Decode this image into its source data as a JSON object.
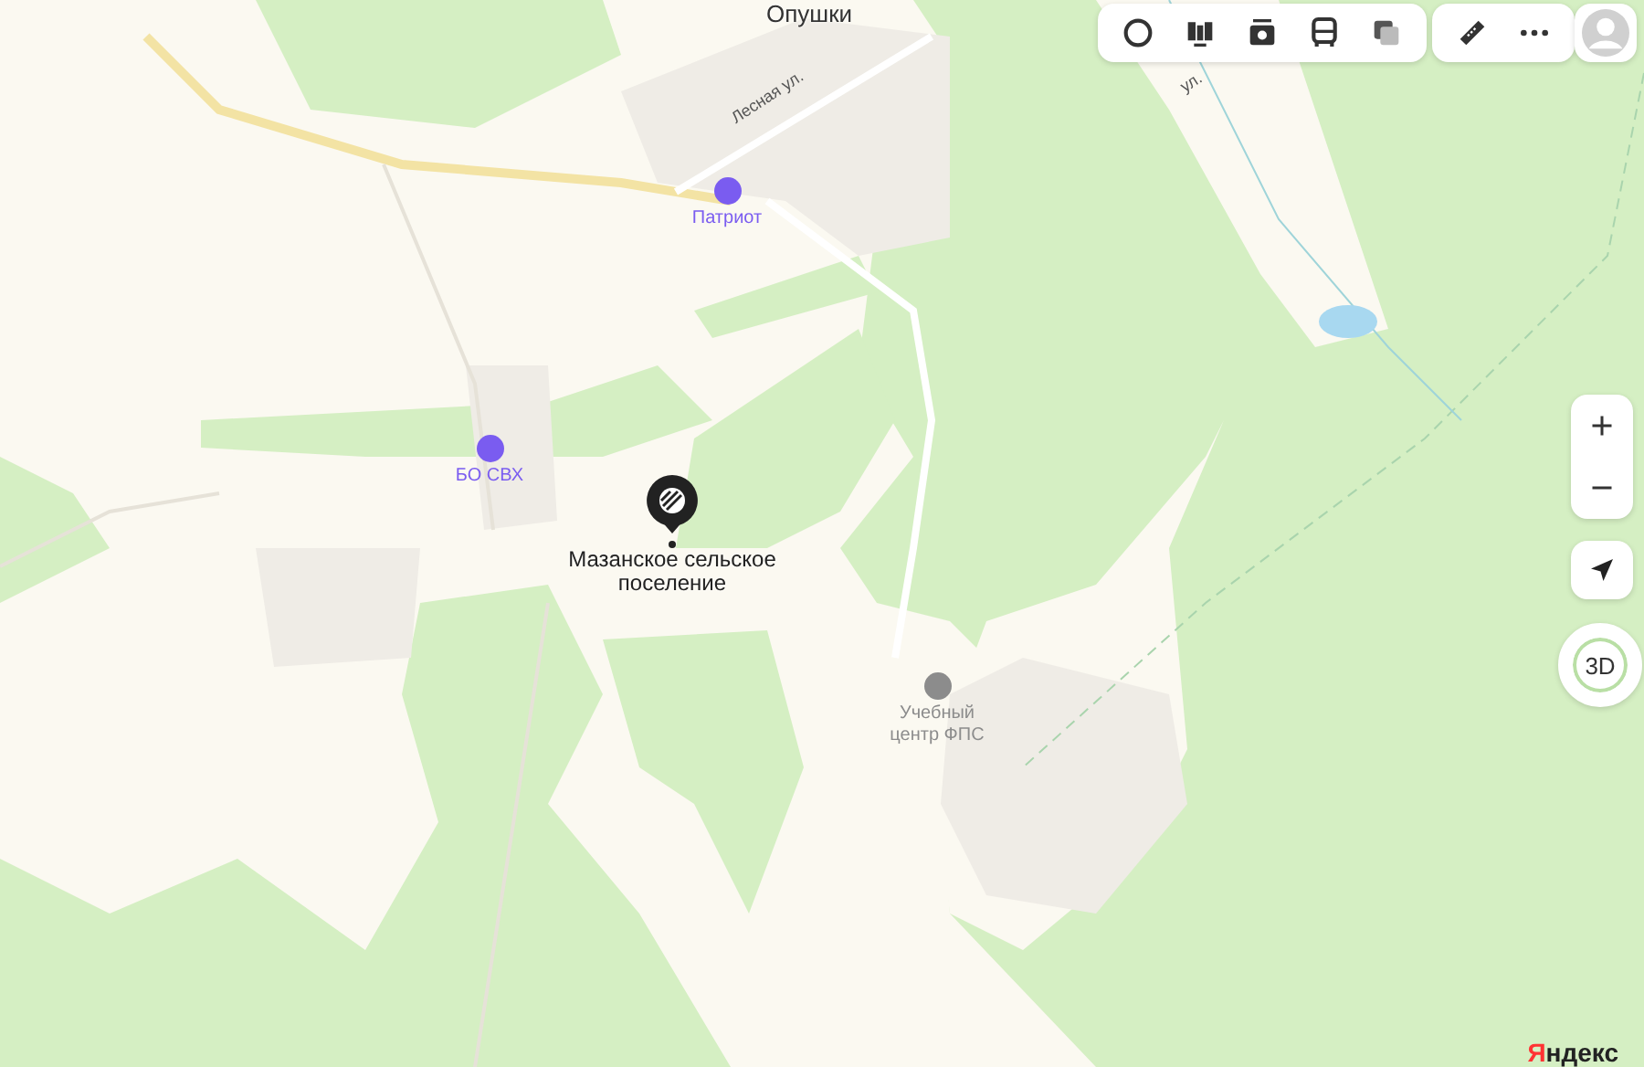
{
  "map": {
    "labels": [
      {
        "text": "Опушки",
        "kind": "place"
      },
      {
        "text": "Лесная ул.",
        "kind": "street"
      },
      {
        "text": "ул.",
        "kind": "street"
      },
      {
        "text": "Патриот",
        "kind": "poi",
        "color": "#7a5cf0"
      },
      {
        "text": "БО СВХ",
        "kind": "poi",
        "color": "#7a5cf0"
      },
      {
        "text": "Мазанское сельское поселение",
        "kind": "selected"
      },
      {
        "text": "Учебный центр ФПС",
        "kind": "poi",
        "color": "#8c8c8c"
      }
    ],
    "logo": "Яндекс"
  },
  "controls": {
    "compass": "3D"
  }
}
